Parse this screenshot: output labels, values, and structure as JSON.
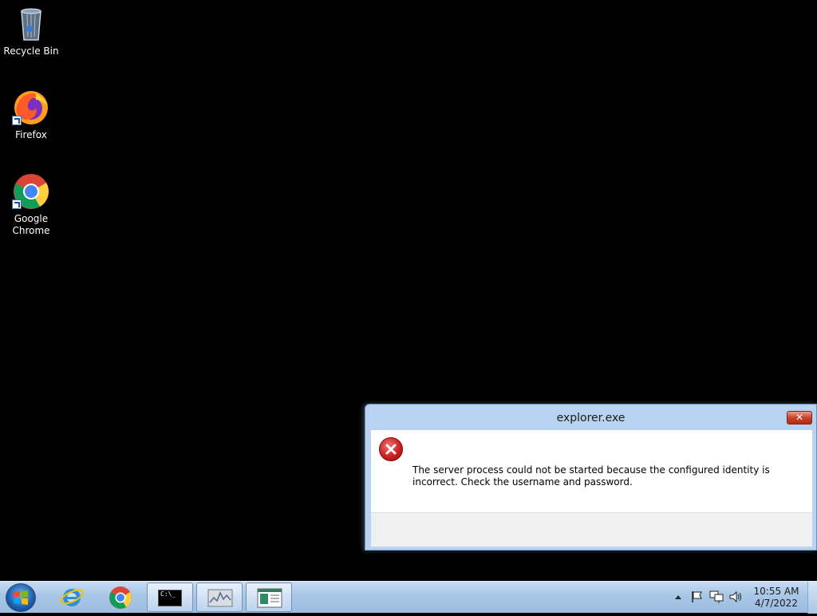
{
  "desktop": {
    "icons": [
      {
        "label": "Recycle Bin",
        "icon": "recycle-bin-icon"
      },
      {
        "label": "Firefox",
        "icon": "firefox-icon"
      },
      {
        "label": "Google\nChrome",
        "icon": "chrome-icon"
      }
    ]
  },
  "dialog": {
    "title": "explorer.exe",
    "close_label": "✕",
    "message": "The server process could not be started because the configured identity is incorrect. Check the username and password.",
    "icon": "error-icon"
  },
  "taskbar": {
    "pinned": [
      {
        "name": "internet-explorer",
        "icon": "internet-explorer-icon"
      },
      {
        "name": "chrome",
        "icon": "chrome-icon"
      },
      {
        "name": "command-prompt",
        "icon": "cmd-icon",
        "text": "C:\\_"
      },
      {
        "name": "performance-monitor",
        "icon": "monitor-icon"
      },
      {
        "name": "app-window",
        "icon": "window-icon"
      }
    ],
    "tray": {
      "time": "10:55 AM",
      "date": "4/7/2022"
    }
  },
  "colors": {
    "desktop_bg": "#000000",
    "taskbar": "#a8c6e6",
    "dialog_frame": "#b8d3ef",
    "close_red": "#c8432b",
    "error_red": "#c81c1c"
  }
}
